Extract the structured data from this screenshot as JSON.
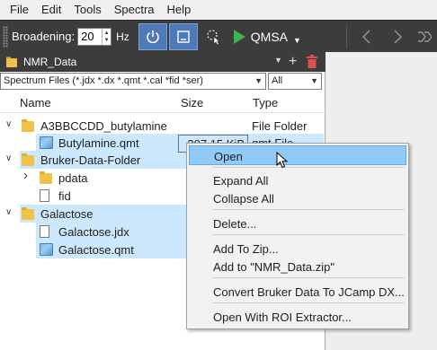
{
  "menu": [
    "File",
    "Edit",
    "Tools",
    "Spectra",
    "Help"
  ],
  "toolbar": {
    "broadening_label": "Broadening:",
    "broadening_value": "20",
    "broadening_unit": "Hz",
    "qmsa_label": "QMSA"
  },
  "folder": {
    "name": "NMR_Data"
  },
  "filter": {
    "types": "Spectrum Files (*.jdx *.dx *.qmt *.cal *fid *ser)",
    "scope": "All"
  },
  "columns": {
    "name": "Name",
    "size": "Size",
    "type": "Type"
  },
  "tree": [
    {
      "name": "A3BBCCDD_butylamine",
      "type": "File Folder",
      "kind": "folder",
      "expanded": true,
      "depth": 0,
      "selected": false
    },
    {
      "name": "Butylamine.qmt",
      "size": "307.15 KiB",
      "type": "qmt File",
      "kind": "qmt",
      "depth": 1,
      "selected": true
    },
    {
      "name": "Bruker-Data-Folder",
      "kind": "folder",
      "expanded": true,
      "depth": 0,
      "selected": true
    },
    {
      "name": "pdata",
      "kind": "folder",
      "expanded": false,
      "depth": 1,
      "selected": false
    },
    {
      "name": "fid",
      "kind": "file",
      "depth": 1,
      "selected": false
    },
    {
      "name": "Galactose",
      "kind": "folder",
      "expanded": true,
      "depth": 0,
      "selected": true
    },
    {
      "name": "Galactose.jdx",
      "kind": "file",
      "depth": 1,
      "selected": true
    },
    {
      "name": "Galactose.qmt",
      "kind": "qmt",
      "depth": 1,
      "selected": true
    }
  ],
  "context_menu": [
    {
      "label": "Open",
      "highlighted": true
    },
    {
      "label": "Expand All"
    },
    {
      "label": "Collapse All"
    },
    {
      "label": "Delete..."
    },
    {
      "label": "Add To Zip..."
    },
    {
      "label": "Add to \"NMR_Data.zip\""
    },
    {
      "label": "Convert Bruker Data To JCamp DX..."
    },
    {
      "label": "Open With ROI Extractor..."
    }
  ],
  "colors": {
    "toolbar_bg": "#3c3c3c",
    "selection": "#cce8ff",
    "menu_highlight": "#91c9f7",
    "folder": "#f0c24a",
    "play": "#3fb24a"
  }
}
